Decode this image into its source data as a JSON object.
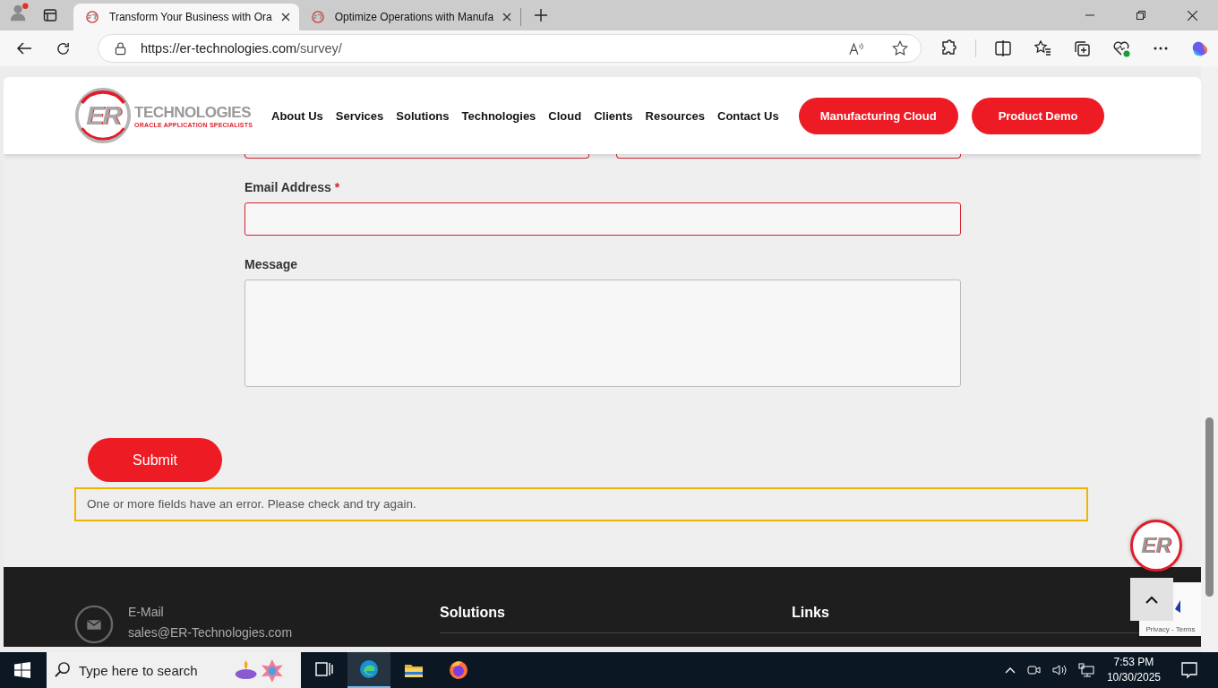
{
  "browser": {
    "tabs": [
      {
        "title": "Transform Your Business with Ora",
        "selected": true
      },
      {
        "title": "Optimize Operations with Manufa",
        "selected": false
      }
    ],
    "url": {
      "host": "https://er-technologies.com",
      "path": "/survey/"
    }
  },
  "header": {
    "logo": {
      "mark": "ER",
      "name": "TECHNOLOGIES",
      "tagline": "ORACLE APPLICATION SPECIALISTS"
    },
    "nav": [
      "About Us",
      "Services",
      "Solutions",
      "Technologies",
      "Cloud",
      "Clients",
      "Resources",
      "Contact Us"
    ],
    "buttons": [
      "Manufacturing Cloud",
      "Product Demo"
    ]
  },
  "form": {
    "partial_fields": [
      {
        "invalid": true
      },
      {
        "invalid": true
      }
    ],
    "fields": [
      {
        "label": "Email Address",
        "required": "*",
        "kind": "input",
        "invalid": true
      },
      {
        "label": "Message",
        "kind": "textarea",
        "invalid": false
      }
    ],
    "submit": "Submit",
    "error_message": "One or more fields have an error. Please check and try again."
  },
  "floating_badge": "ER",
  "recaptcha": {
    "links": "Privacy - Terms"
  },
  "footer": {
    "contact": {
      "label": "E-Mail",
      "value": "sales@ER-Technologies.com"
    },
    "headings": [
      "Solutions",
      "Links"
    ]
  },
  "taskbar": {
    "search_placeholder": "Type here to search",
    "apps": [
      {
        "kind": "taskview",
        "selected": false
      },
      {
        "kind": "edge",
        "selected": true
      },
      {
        "kind": "explorer",
        "selected": false
      },
      {
        "kind": "firefox",
        "selected": false
      }
    ],
    "time": "7:53 PM",
    "date": "10/30/2025"
  }
}
